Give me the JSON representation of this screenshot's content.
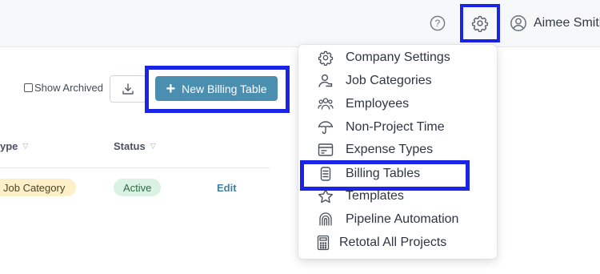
{
  "header": {
    "help_icon": "question-circle-icon",
    "settings_icon": "gear-icon",
    "user_icon": "user-circle-icon",
    "user_name": "Aimee Smith"
  },
  "toolbar": {
    "show_archived_label": "Show Archived",
    "show_archived_checked": false,
    "download_icon": "download-icon",
    "new_button_label": "New Billing Table",
    "new_button_icon": "plus-icon"
  },
  "table": {
    "columns": [
      {
        "label": "ype"
      },
      {
        "label": "Status"
      }
    ],
    "rows": [
      {
        "type": "Job Category",
        "status": "Active",
        "action": "Edit"
      }
    ]
  },
  "settings_menu": {
    "items": [
      {
        "label": "Company Settings",
        "icon": "gear-icon"
      },
      {
        "label": "Job Categories",
        "icon": "user-hand-icon"
      },
      {
        "label": "Employees",
        "icon": "users-icon"
      },
      {
        "label": "Non-Project Time",
        "icon": "umbrella-icon"
      },
      {
        "label": "Expense Types",
        "icon": "receipt-icon"
      },
      {
        "label": "Billing Tables",
        "icon": "abacus-icon"
      },
      {
        "label": "Templates",
        "icon": "star-icon"
      },
      {
        "label": "Pipeline Automation",
        "icon": "fingerprint-icon"
      },
      {
        "label": "Retotal All Projects",
        "icon": "calculator-icon"
      }
    ]
  },
  "colors": {
    "highlight": "#1a23e6",
    "primary_button": "#4a8fb0",
    "badge_category_bg": "#fdefc8",
    "badge_status_bg": "#d9f2e3",
    "link": "#3e7fa3"
  }
}
